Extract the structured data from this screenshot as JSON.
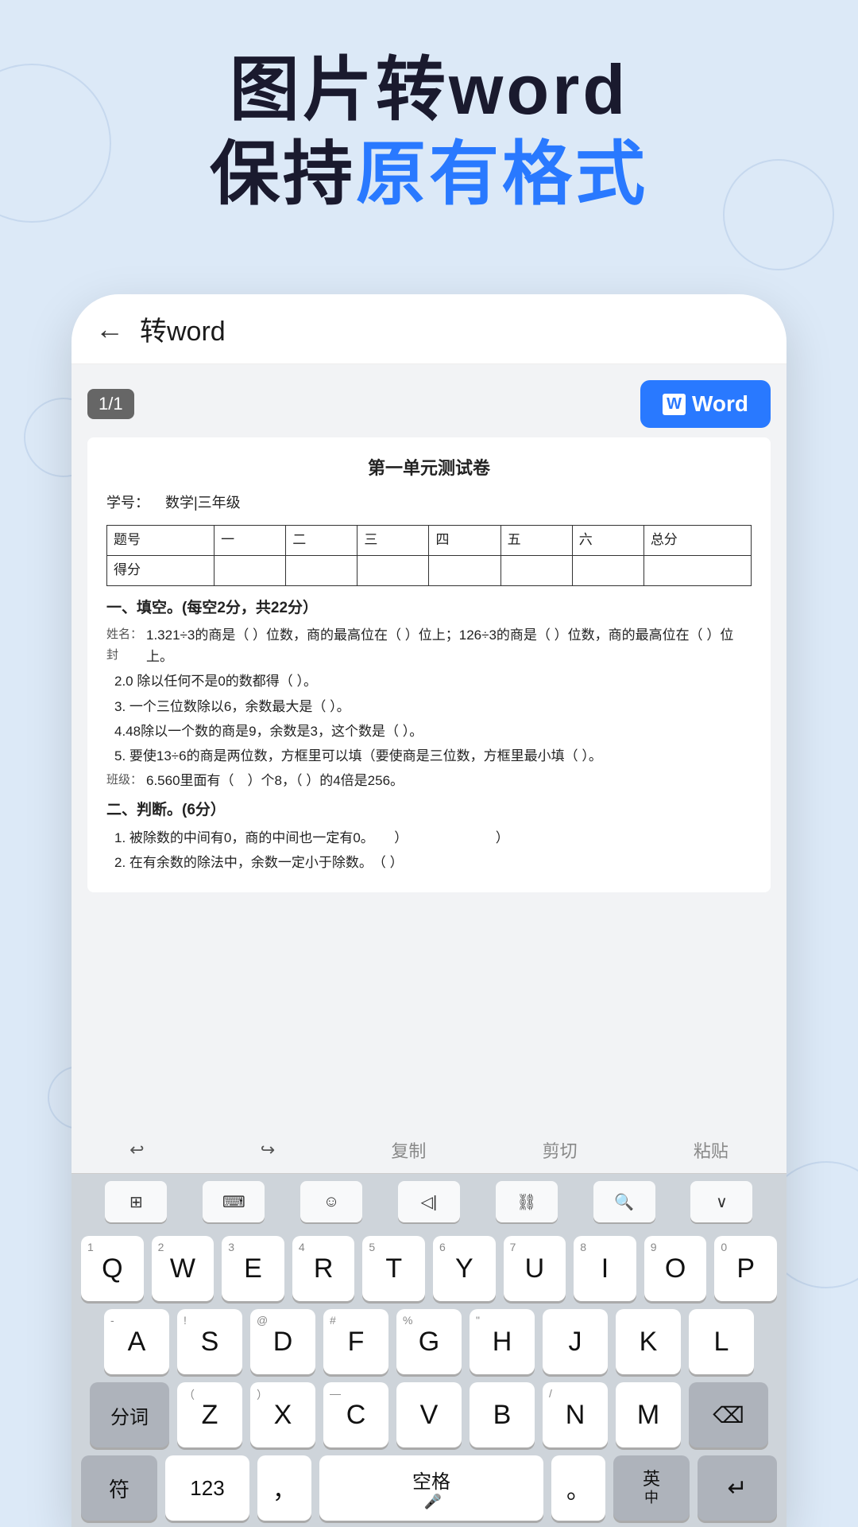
{
  "hero": {
    "line1": "图片转word",
    "line2_part1": "保持",
    "line2_part2": "原有格式"
  },
  "app": {
    "back_label": "←",
    "title": "转word",
    "page_badge": "1/1",
    "word_button": "Word"
  },
  "document": {
    "title": "第一单元测试卷",
    "subtitle_label": "学号：",
    "subtitle_value": "数学|三年级",
    "table_headers": [
      "题号",
      "一",
      "二",
      "三",
      "四",
      "五",
      "六",
      "总分"
    ],
    "table_row2": [
      "得分",
      "",
      "",
      "",
      "",
      "",
      "",
      ""
    ],
    "section1": "一、填空。(每空2分，共22分）",
    "items": [
      "1.321÷3的商是（ ）位数，商的最高位在（ ）位上；126÷3的商是（ ）位数，商的最高位在（ ）位上。",
      "2.0 除以任何不是0的数都得（ ）。",
      "3. 一个三位数除以6，余数最大是（ ）。",
      "4.48除以一个数的商是9，余数是3，这个数是（ ）。",
      "5. 要使13÷6的商是两位数，方框里可以填（要使商是三位数，方框里最小填（ ）。",
      "6.560里面有（　）个8，（ ）的4倍是256。"
    ],
    "section2": "二、判断。(6分）",
    "judge_items": [
      "1. 被除数的中间有0，商的中间也一定有0。　　）　　　　　　　）",
      "2. 在有余数的除法中，余数一定小于除数。　（ ）"
    ],
    "side_label1": "姓名：封",
    "side_label2": "班级："
  },
  "keyboard": {
    "toolbar": {
      "undo": "↩",
      "redo": "↪",
      "copy": "复制",
      "cut": "剪切",
      "paste": "粘贴"
    },
    "top_icons": [
      "⊞",
      "⌨",
      "☺",
      "◁|",
      "⛓",
      "🔍",
      "∨"
    ],
    "rows": [
      {
        "keys": [
          {
            "label": "Q",
            "sub": "1"
          },
          {
            "label": "W",
            "sub": "2"
          },
          {
            "label": "E",
            "sub": "3"
          },
          {
            "label": "R",
            "sub": "4"
          },
          {
            "label": "T",
            "sub": "5"
          },
          {
            "label": "Y",
            "sub": "6"
          },
          {
            "label": "U",
            "sub": "7"
          },
          {
            "label": "I",
            "sub": "8"
          },
          {
            "label": "O",
            "sub": "9"
          },
          {
            "label": "P",
            "sub": "0"
          }
        ]
      },
      {
        "keys": [
          {
            "label": "A",
            "sub": "-"
          },
          {
            "label": "S",
            "sub": "!"
          },
          {
            "label": "D",
            "sub": "@"
          },
          {
            "label": "F",
            "sub": "#"
          },
          {
            "label": "G",
            "sub": "%"
          },
          {
            "label": "H",
            "sub": "\""
          },
          {
            "label": "J",
            "sub": ""
          },
          {
            "label": "K",
            "sub": ""
          },
          {
            "label": "L",
            "sub": ""
          }
        ]
      }
    ],
    "bottom_row": {
      "fenci": "分词",
      "row3_keys": [
        {
          "label": "Z",
          "sub": "（"
        },
        {
          "label": "X",
          "sub": "）"
        },
        {
          "label": "C",
          "sub": "—"
        },
        {
          "label": "V",
          "sub": ""
        },
        {
          "label": "B",
          "sub": ""
        },
        {
          "label": "N",
          "sub": "/"
        },
        {
          "label": "M",
          "sub": ""
        }
      ],
      "delete": "⌫"
    },
    "last_row": {
      "sym": "符",
      "num": "123",
      "comma": "，",
      "space": "空格",
      "period": "。",
      "lang": "英\n中",
      "enter": "↵"
    }
  }
}
